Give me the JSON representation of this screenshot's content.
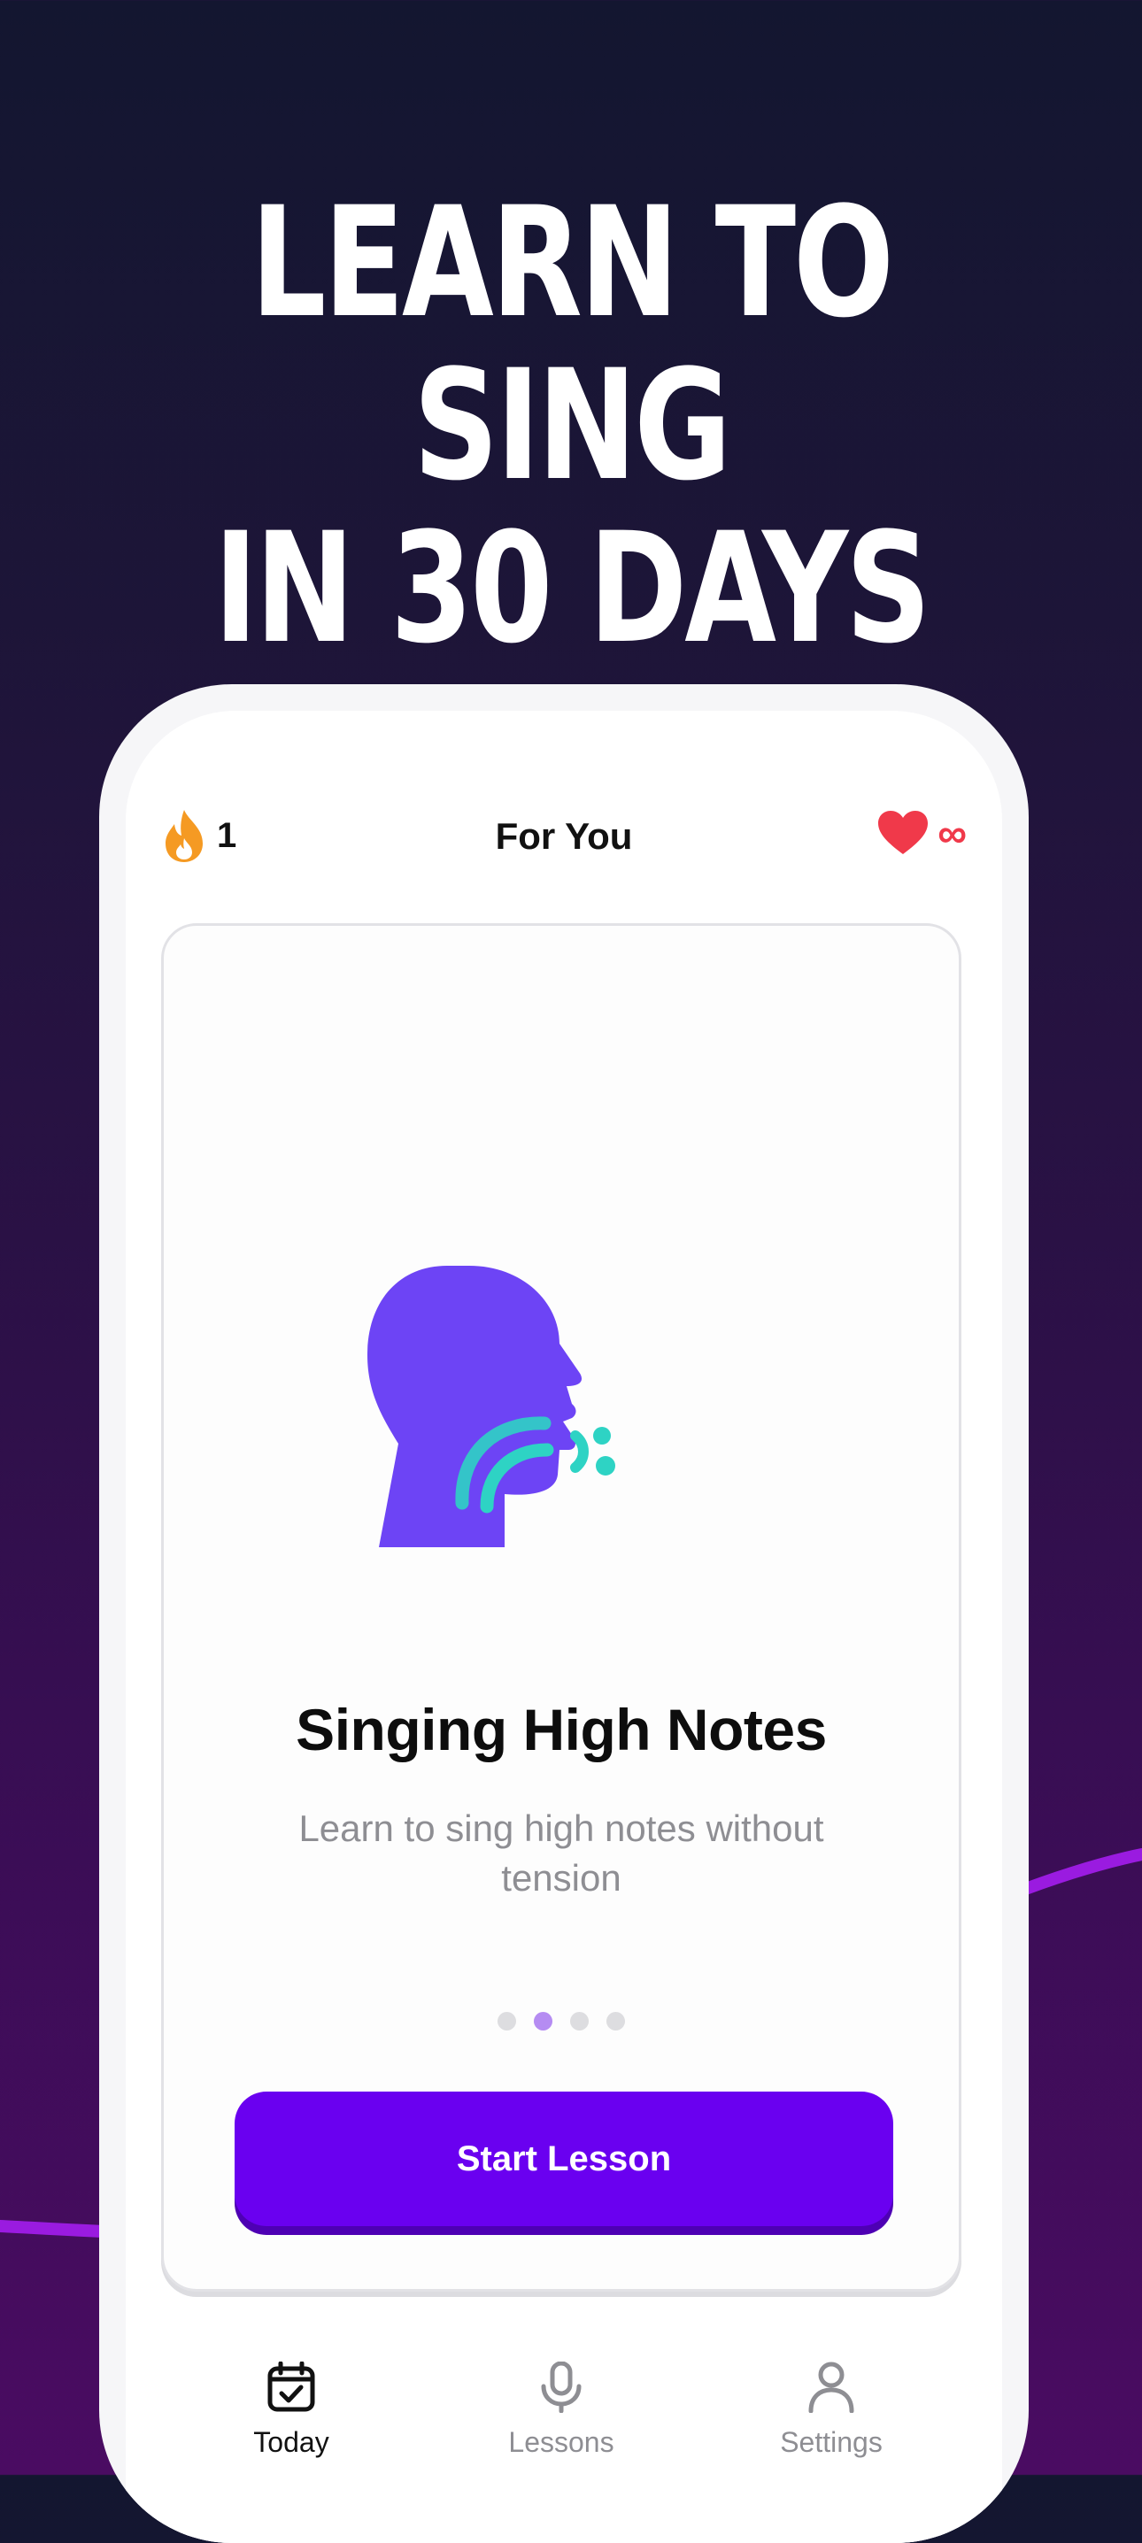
{
  "headline": {
    "line1": "LEARN TO SING",
    "line2": "IN 30 DAYS"
  },
  "app": {
    "title": "For You",
    "streak": {
      "icon": "flame-icon",
      "count": "1"
    },
    "lives": {
      "icon": "heart-icon",
      "count": "∞"
    }
  },
  "lesson": {
    "title": "Singing High Notes",
    "description": "Learn to sing high notes without tension",
    "illustration": "singing-head-icon",
    "page_indicator": {
      "total": 4,
      "active_index": 2
    },
    "cta_label": "Start Lesson"
  },
  "tabs": [
    {
      "label": "Today",
      "icon": "calendar-check-icon",
      "active": true
    },
    {
      "label": "Lessons",
      "icon": "microphone-icon",
      "active": false
    },
    {
      "label": "Settings",
      "icon": "person-icon",
      "active": false
    }
  ],
  "colors": {
    "accent": "#6a00f0",
    "streak": "#f59a23",
    "heart": "#f0394a",
    "illustration_head": "#6d44f5",
    "illustration_waves": "#2ed3c4",
    "dot_active": "#b58cf2"
  }
}
